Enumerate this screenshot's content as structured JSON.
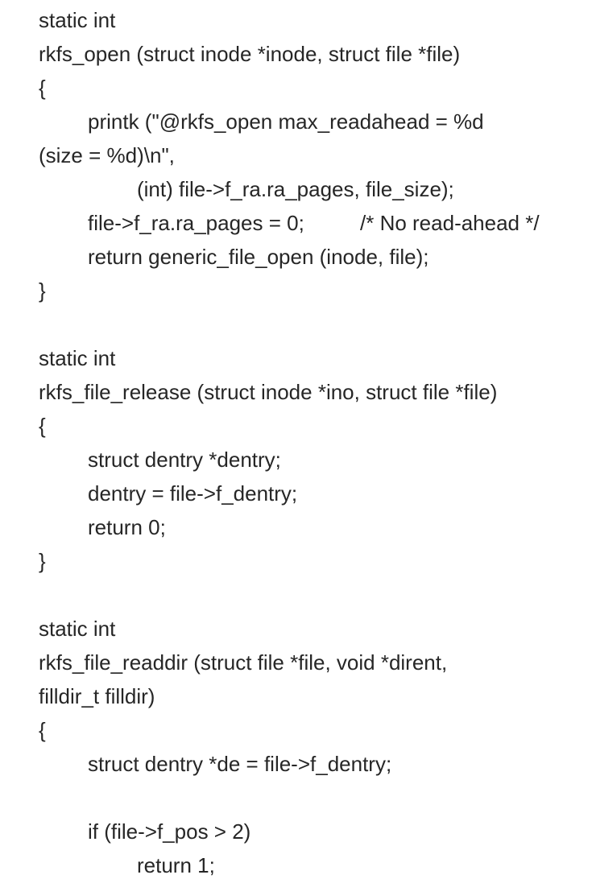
{
  "lines": [
    "static int",
    "rkfs_open (struct inode *inode, struct file *file)",
    "{",
    "printk (\"@rkfs_open max_readahead = %d",
    "(size = %d)\\n\",",
    "(int) file->f_ra.ra_pages, file_size);",
    "file->f_ra.ra_pages = 0;",
    "/* No read-ahead */",
    "return generic_file_open (inode, file);",
    "}",
    "static int",
    "rkfs_file_release (struct inode *ino, struct file *file)",
    "{",
    "struct dentry *dentry;",
    "dentry = file->f_dentry;",
    "return 0;",
    "}",
    "static int",
    "rkfs_file_readdir (struct file *file, void *dirent,",
    "filldir_t filldir)",
    "{",
    "struct dentry *de = file->f_dentry;",
    "if (file->f_pos > 2)",
    "return 1;"
  ]
}
